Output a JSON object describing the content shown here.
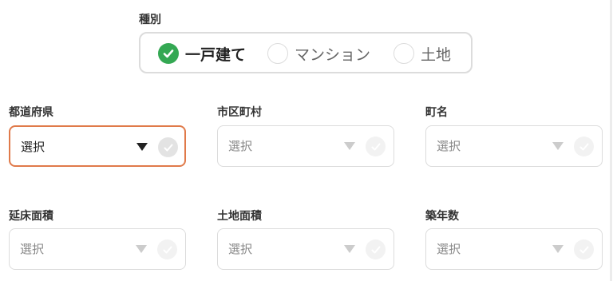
{
  "property_type": {
    "label": "種別",
    "options": [
      {
        "label": "一戸建て",
        "checked": true
      },
      {
        "label": "マンション",
        "checked": false
      },
      {
        "label": "土地",
        "checked": false
      }
    ]
  },
  "fields": [
    {
      "label": "都道府県",
      "value": "選択",
      "active": true
    },
    {
      "label": "市区町村",
      "value": "選択",
      "active": false
    },
    {
      "label": "町名",
      "value": "選択",
      "active": false
    },
    {
      "label": "延床面積",
      "value": "選択",
      "active": false
    },
    {
      "label": "土地面積",
      "value": "選択",
      "active": false
    },
    {
      "label": "築年数",
      "value": "選択",
      "active": false
    }
  ],
  "colors": {
    "check_green": "#34a853",
    "active_border": "#e07a4a",
    "border": "#dcdcdc"
  },
  "icons": {
    "checked": "check-circle-icon",
    "dropdown": "triangle-down-icon",
    "status": "check-circle-icon"
  }
}
